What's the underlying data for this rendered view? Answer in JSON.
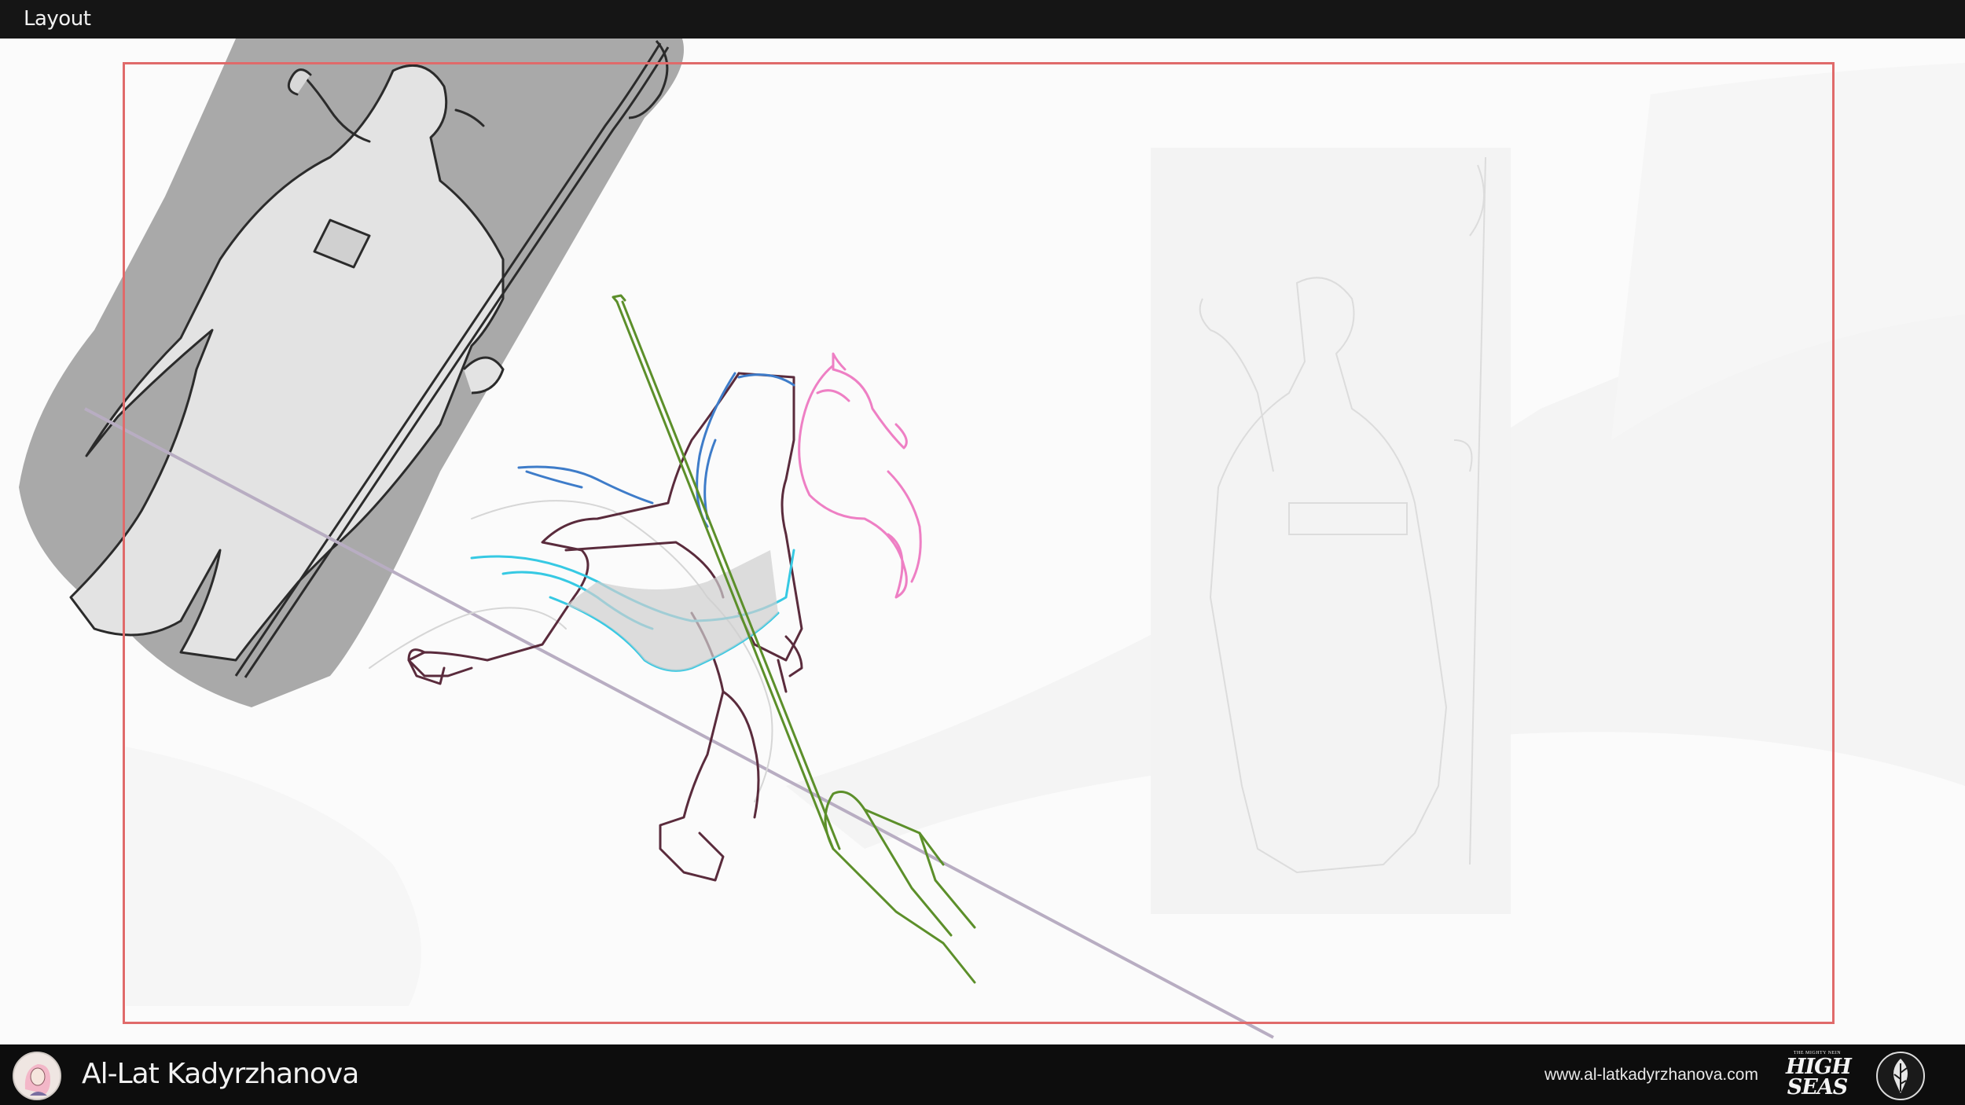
{
  "header": {
    "title": "Layout"
  },
  "footer": {
    "author_name": "Al-Lat Kadyrzhanova",
    "website": "www.al-latkadyrzhanova.com",
    "logo_text": {
      "kicker": "THE MIGHTY NEIN",
      "line1": "HIGH",
      "line2": "SEAS"
    },
    "avatar_icon": "artist-portrait-icon",
    "emblem_icon": "leaf-emblem-icon"
  },
  "colors": {
    "top_bar": "#151515",
    "bottom_bar": "#0d0d0d",
    "canvas_bg": "#fbfbfb",
    "safe_frame": "#e06a6a",
    "reference_panel": "#a9a9a9",
    "sketch_body": "#5a2b3c",
    "sketch_hair": "#ee7fc4",
    "sketch_hood": "#3e7cc9",
    "sketch_cloth": "#36c9e3",
    "sketch_spear": "#5c8f2a",
    "perspective_line": "#b8adc2"
  }
}
